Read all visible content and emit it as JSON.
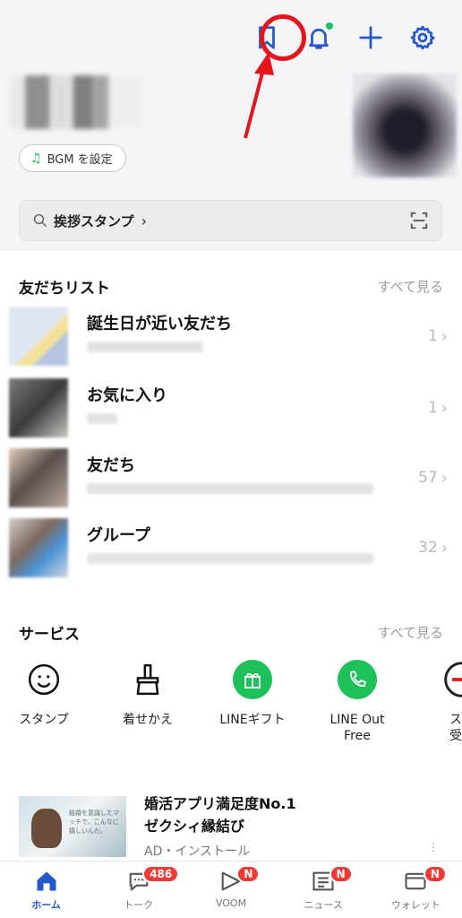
{
  "header": {
    "icons": [
      "bookmark-icon",
      "bell-icon",
      "plus-icon",
      "gear-icon"
    ],
    "bgm_button": "BGM を設定",
    "search_label": "挨拶スタンプ",
    "accent_color": "#2458c9",
    "highlight_color": "#e4161b"
  },
  "friends": {
    "title": "友だちリスト",
    "see_all": "すべて見る",
    "rows": [
      {
        "name": "誕生日が近い友だち",
        "count": "1"
      },
      {
        "name": "お気に入り",
        "count": "1"
      },
      {
        "name": "友だち",
        "count": "57"
      },
      {
        "name": "グループ",
        "count": "32"
      }
    ]
  },
  "services": {
    "title": "サービス",
    "see_all": "すべて見る",
    "items": [
      {
        "label": "スタンプ",
        "icon": "smile-icon"
      },
      {
        "label": "着せかえ",
        "icon": "brush-icon"
      },
      {
        "label": "LINEギフト",
        "icon": "gift-icon"
      },
      {
        "label": "LINE Out\nFree",
        "icon": "phone-icon"
      },
      {
        "label": "スシ\n受付",
        "icon": "sushi-icon"
      }
    ]
  },
  "ad": {
    "title_line1": "婚活アプリ満足度No.1",
    "title_line2": "ゼクシィ縁結び",
    "label": "AD・インストール",
    "image_text": "結婚を意識したマッチで、こんなに嬉しいんだ。"
  },
  "nav": {
    "items": [
      {
        "label": "ホーム",
        "icon": "home-icon",
        "badge": ""
      },
      {
        "label": "トーク",
        "icon": "chat-icon",
        "badge": "486"
      },
      {
        "label": "VOOM",
        "icon": "voom-icon",
        "badge": "N"
      },
      {
        "label": "ニュース",
        "icon": "news-icon",
        "badge": "N"
      },
      {
        "label": "ウォレット",
        "icon": "wallet-icon",
        "badge": "N"
      }
    ]
  }
}
